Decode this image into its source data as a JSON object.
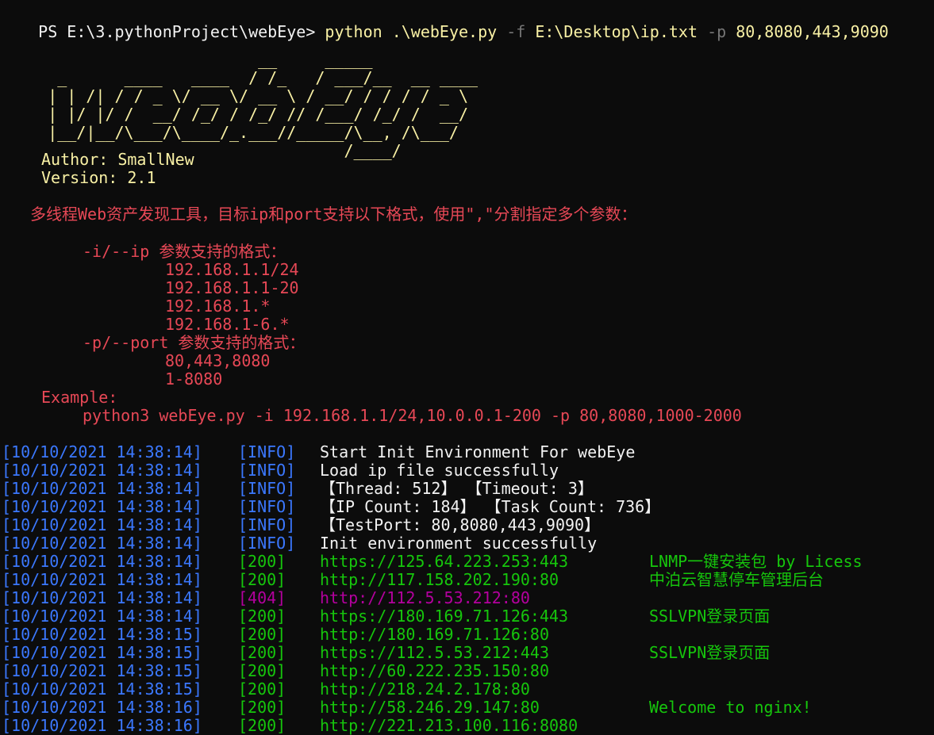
{
  "terminal": {
    "prompt": "PS E:\\3.pythonProject\\webEye> ",
    "command_parts": [
      {
        "text": "python .\\webEye.py ",
        "style": "cmd"
      },
      {
        "text": "-f ",
        "style": "flag"
      },
      {
        "text": "E:\\Desktop\\ip.txt ",
        "style": "cmd"
      },
      {
        "text": "-p ",
        "style": "flag"
      },
      {
        "text": "80,8080,443,9090",
        "style": "cmd"
      }
    ]
  },
  "banner": {
    "ascii_lines": [
      "                           __     _____",
      "      _      ____   ____  / /_   / ___/__  __ ____",
      "     | | /| / / _ \\/ __ \\/ __ \\ / __/ / / / / _ \\",
      "     | |/ |/ /  __/ /_/ / /_/ // /___/ /_/ /  __/",
      "     |__/|__/\\___/\\____/_.___//_____/\\__, /\\___/",
      "                                    /____/"
    ],
    "author": "Author: SmallNew",
    "version": "Version: 2.1"
  },
  "help": {
    "intro": "多线程Web资产发现工具，目标ip和port支持以下格式，使用\",\"分割指定多个参数：",
    "ip_header": "-i/--ip 参数支持的格式：",
    "ip_formats": [
      "192.168.1.1/24",
      "192.168.1.1-20",
      "192.168.1.*",
      "192.168.1-6.*"
    ],
    "port_header": "-p/--port 参数支持的格式：",
    "port_formats": [
      "80,443,8080",
      "1-8080"
    ],
    "example_label": "Example:",
    "example_cmd": "python3 webEye.py -i 192.168.1.1/24,10.0.0.1-200 -p 80,8080,1000-2000"
  },
  "log": [
    {
      "ts": "[10/10/2021 14:38:14]",
      "level": "[INFO]",
      "level_color": "#3b78ff",
      "msg": "Start Init Environment For webEye",
      "msg_color": "#f2f2f2",
      "title": ""
    },
    {
      "ts": "[10/10/2021 14:38:14]",
      "level": "[INFO]",
      "level_color": "#3b78ff",
      "msg": "Load ip file successfully",
      "msg_color": "#f2f2f2",
      "title": ""
    },
    {
      "ts": "[10/10/2021 14:38:14]",
      "level": "[INFO]",
      "level_color": "#3b78ff",
      "msg": "【Thread: 512】 【Timeout: 3】",
      "msg_color": "#f2f2f2",
      "title": ""
    },
    {
      "ts": "[10/10/2021 14:38:14]",
      "level": "[INFO]",
      "level_color": "#3b78ff",
      "msg": "【IP Count: 184】 【Task Count: 736】",
      "msg_color": "#f2f2f2",
      "title": ""
    },
    {
      "ts": "[10/10/2021 14:38:14]",
      "level": "[INFO]",
      "level_color": "#3b78ff",
      "msg": "【TestPort: 80,8080,443,9090】",
      "msg_color": "#f2f2f2",
      "title": ""
    },
    {
      "ts": "[10/10/2021 14:38:14]",
      "level": "[INFO]",
      "level_color": "#3b78ff",
      "msg": "Init environment successfully",
      "msg_color": "#f2f2f2",
      "title": ""
    },
    {
      "ts": "[10/10/2021 14:38:14]",
      "level": "[200]",
      "level_color": "#16c60c",
      "msg": "https://125.64.223.253:443",
      "msg_color": "#16c60c",
      "title": "LNMP一键安装包 by Licess"
    },
    {
      "ts": "[10/10/2021 14:38:14]",
      "level": "[200]",
      "level_color": "#16c60c",
      "msg": "http://117.158.202.190:80",
      "msg_color": "#16c60c",
      "title": "中泊云智慧停车管理后台"
    },
    {
      "ts": "[10/10/2021 14:38:14]",
      "level": "[404]",
      "level_color": "#b4009e",
      "msg": "http://112.5.53.212:80",
      "msg_color": "#b4009e",
      "title": ""
    },
    {
      "ts": "[10/10/2021 14:38:14]",
      "level": "[200]",
      "level_color": "#16c60c",
      "msg": "https://180.169.71.126:443",
      "msg_color": "#16c60c",
      "title": "SSLVPN登录页面"
    },
    {
      "ts": "[10/10/2021 14:38:15]",
      "level": "[200]",
      "level_color": "#16c60c",
      "msg": "http://180.169.71.126:80",
      "msg_color": "#16c60c",
      "title": ""
    },
    {
      "ts": "[10/10/2021 14:38:15]",
      "level": "[200]",
      "level_color": "#16c60c",
      "msg": "https://112.5.53.212:443",
      "msg_color": "#16c60c",
      "title": "SSLVPN登录页面"
    },
    {
      "ts": "[10/10/2021 14:38:15]",
      "level": "[200]",
      "level_color": "#16c60c",
      "msg": "http://60.222.235.150:80",
      "msg_color": "#16c60c",
      "title": ""
    },
    {
      "ts": "[10/10/2021 14:38:15]",
      "level": "[200]",
      "level_color": "#16c60c",
      "msg": "http://218.24.2.178:80",
      "msg_color": "#16c60c",
      "title": ""
    },
    {
      "ts": "[10/10/2021 14:38:16]",
      "level": "[200]",
      "level_color": "#16c60c",
      "msg": "http://58.246.29.147:80",
      "msg_color": "#16c60c",
      "title": "Welcome to nginx!"
    },
    {
      "ts": "[10/10/2021 14:38:16]",
      "level": "[200]",
      "level_color": "#16c60c",
      "msg": "http://221.213.100.116:8080",
      "msg_color": "#16c60c",
      "title": ""
    }
  ],
  "colors": {
    "background": "#0c0c0c",
    "yellow": "#f9f1a5",
    "red": "#e74856",
    "blue": "#3b78ff",
    "green": "#16c60c",
    "magenta": "#b4009e",
    "white": "#f2f2f2"
  }
}
